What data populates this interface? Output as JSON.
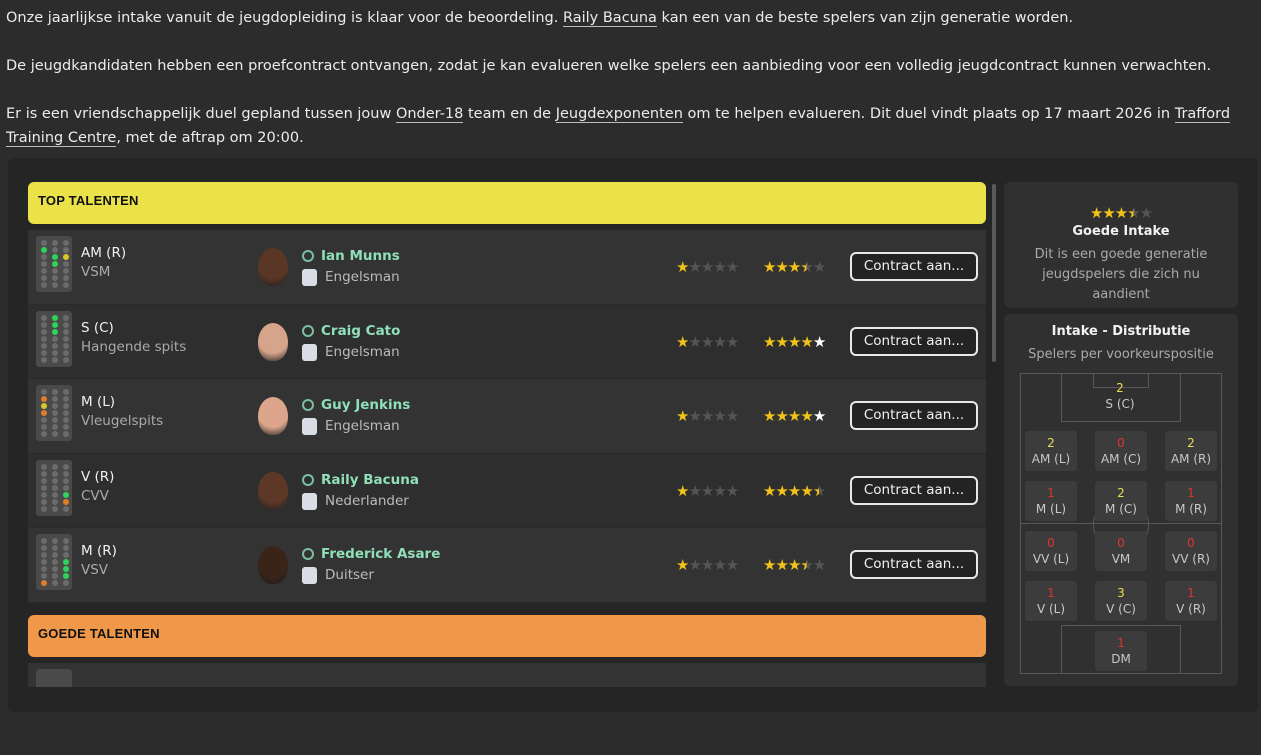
{
  "intro": {
    "p1_a": "Onze jaarlijkse intake vanuit de jeugdopleiding is klaar voor de beoordeling. ",
    "p1_link": "Raily Bacuna",
    "p1_b": " kan een van de beste spelers van zijn generatie worden.",
    "p2": "De jeugdkandidaten hebben een proefcontract ontvangen, zodat je kan evalueren welke spelers een aanbieding voor een volledig jeugdcontract kunnen verwachten.",
    "p3_a": "Er is een vriendschappelijk duel gepland tussen jouw ",
    "p3_link1": "Onder-18",
    "p3_b": " team en de ",
    "p3_link2": "Jeugdexponenten",
    "p3_c": " om te helpen evalueren. Dit duel vindt plaats op 17 maart 2026 in ",
    "p3_link3": "Trafford Training Centre",
    "p3_d": ", met de aftrap om 20:00."
  },
  "sections": {
    "top": "TOP TALENTEN",
    "good": "GOEDE TALENTEN"
  },
  "button_label": "Contract aan...",
  "players": [
    {
      "position": "AM (R)",
      "role": "VSM",
      "name": "Ian Munns",
      "nationality": "Engelsman",
      "ability_stars": 1,
      "potential_stars": 3.5,
      "skin": "#5a3624",
      "flag": "england-icon"
    },
    {
      "position": "S (C)",
      "role": "Hangende spits",
      "name": "Craig Cato",
      "nationality": "Engelsman",
      "ability_stars": 1,
      "potential_stars": 4,
      "skin": "#d5a48a",
      "flag": "england-icon"
    },
    {
      "position": "M (L)",
      "role": "Vleugelspits",
      "name": "Guy Jenkins",
      "nationality": "Engelsman",
      "ability_stars": 1,
      "potential_stars": 4,
      "skin": "#dca58c",
      "flag": "england-icon"
    },
    {
      "position": "V (R)",
      "role": "CVV",
      "name": "Raily Bacuna",
      "nationality": "Nederlander",
      "ability_stars": 1,
      "potential_stars": 4.5,
      "skin": "#5e3826",
      "flag": "netherlands-icon"
    },
    {
      "position": "M (R)",
      "role": "VSV",
      "name": "Frederick Asare",
      "nationality": "Duitser",
      "ability_stars": 1,
      "potential_stars": 3.5,
      "skin": "#3a2418",
      "flag": "germany-icon"
    }
  ],
  "intake": {
    "stars": 3.5,
    "title": "Goede Intake",
    "description": "Dit is een goede generatie jeugdspelers die zich nu aandient"
  },
  "distribution": {
    "title": "Intake - Distributie",
    "subtitle": "Spelers per voorkeurspositie",
    "cells": [
      {
        "label": "S (C)",
        "count": "2",
        "color": "yellow"
      },
      {
        "label": "AM (L)",
        "count": "2",
        "color": "yellow"
      },
      {
        "label": "AM (C)",
        "count": "0",
        "color": "red"
      },
      {
        "label": "AM (R)",
        "count": "2",
        "color": "yellow"
      },
      {
        "label": "M (L)",
        "count": "1",
        "color": "red"
      },
      {
        "label": "M (C)",
        "count": "2",
        "color": "yellow"
      },
      {
        "label": "M (R)",
        "count": "1",
        "color": "red"
      },
      {
        "label": "VV (L)",
        "count": "0",
        "color": "red"
      },
      {
        "label": "VM",
        "count": "0",
        "color": "red"
      },
      {
        "label": "VV (R)",
        "count": "0",
        "color": "red"
      },
      {
        "label": "V (L)",
        "count": "1",
        "color": "red"
      },
      {
        "label": "V (C)",
        "count": "3",
        "color": "yellow"
      },
      {
        "label": "V (R)",
        "count": "1",
        "color": "red"
      },
      {
        "label": "DM",
        "count": "1",
        "color": "red"
      }
    ]
  },
  "colors": {
    "top_header": "#ebe249",
    "good_header": "#f0984a",
    "star": "#f0c21a",
    "player_name": "#8fe0b8"
  }
}
